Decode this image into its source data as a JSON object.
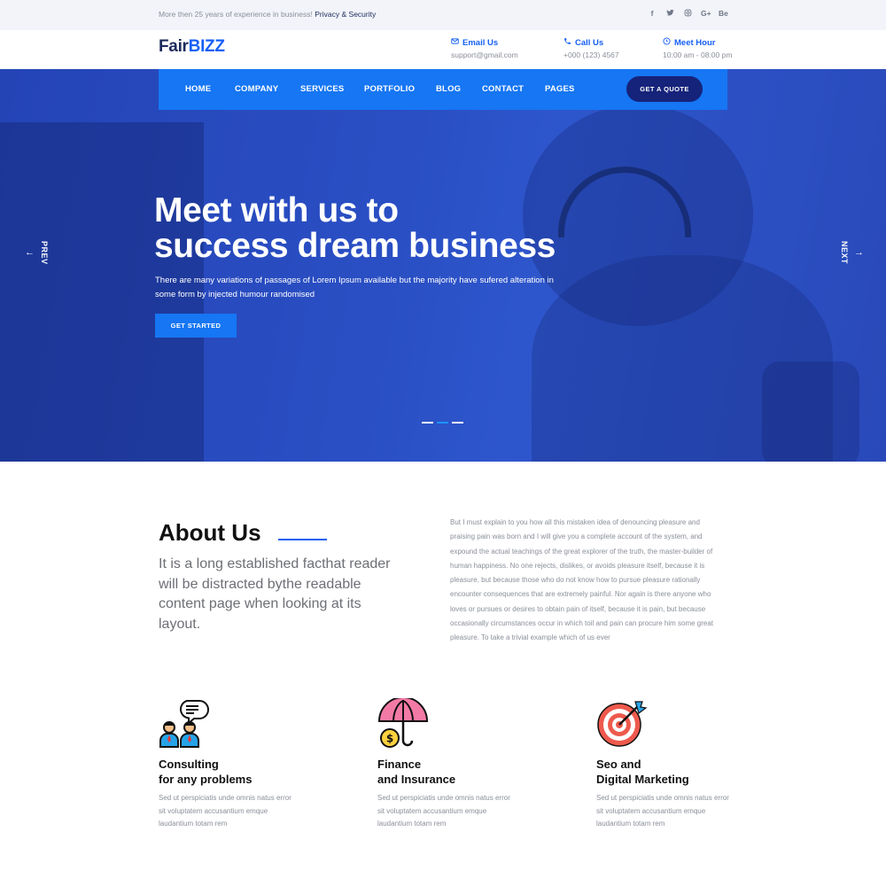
{
  "topbar": {
    "intro": "More then 25 years of experience in business!",
    "link": "Privacy & Security",
    "socials": [
      "f",
      "t",
      "ig",
      "G+",
      "Be"
    ]
  },
  "header": {
    "logo_part1": "Fair",
    "logo_part2": "BIZZ",
    "email": {
      "title": "Email Us",
      "value": "support@gmail.com",
      "icon": "envelope-icon"
    },
    "call": {
      "title": "Call Us",
      "value": "+000 (123) 4567",
      "icon": "phone-icon"
    },
    "hour": {
      "title": "Meet Hour",
      "value": "10:00 am - 08:00 pm",
      "icon": "clock-icon"
    }
  },
  "nav": {
    "items": [
      "HOME",
      "COMPANY",
      "SERVICES",
      "PORTFOLIO",
      "BLOG",
      "CONTACT",
      "PAGES"
    ],
    "quote": "GET A QUOTE"
  },
  "hero": {
    "title_line1": "Meet with us to",
    "title_line2": "success dream business",
    "text": "There are many variations of passages of Lorem Ipsum available but the majority have sufered alteration in some form by injected humour randomised",
    "button": "GET STARTED",
    "prev": "PREV",
    "next": "NEXT",
    "slides": 3,
    "active_slide": 2
  },
  "about": {
    "title": "About Us",
    "lead": "It is a long established facthat reader will be distracted bythe readable content page when looking at its layout.",
    "body": "But I must explain to you how all this mistaken idea of denouncing pleasure and praising pain was born and I will give you a complete account of the system, and expound the actual teachings of the great explorer of the truth, the master-builder of human happiness. No one rejects, dislikes, or avoids pleasure itself, because it is pleasure, but because those who do not know how to pursue pleasure rationally encounter consequences that are extremely painful. Nor again is there anyone who loves or pursues or desires to obtain pain of itself, because it is pain, but because occasionally circumstances occur in which toil and pain can procure him some great pleasure. To take a trivial example which of us ever"
  },
  "features": [
    {
      "line1": "Consulting",
      "line2": "for any problems",
      "text": "Sed ut perspiciatis unde omnis natus error sit voluptatem accusantium emque laudantium totam rem",
      "icon": "consulting-icon"
    },
    {
      "line1": "Finance",
      "line2": "and Insurance",
      "text": "Sed ut perspiciatis unde omnis natus error sit voluptatem accusantium emque laudantium totam rem",
      "icon": "umbrella-icon"
    },
    {
      "line1": "Seo and",
      "line2": "Digital Marketing",
      "text": "Sed ut perspiciatis unde omnis natus error sit voluptatem accusantium emque laudantium totam rem",
      "icon": "target-icon"
    }
  ],
  "colors": {
    "primary": "#1760f5",
    "navy": "#1c2a5c",
    "nav_bg": "#1676f3",
    "quote_bg": "#15237a",
    "hero_overlay": "#2a4fc4"
  }
}
